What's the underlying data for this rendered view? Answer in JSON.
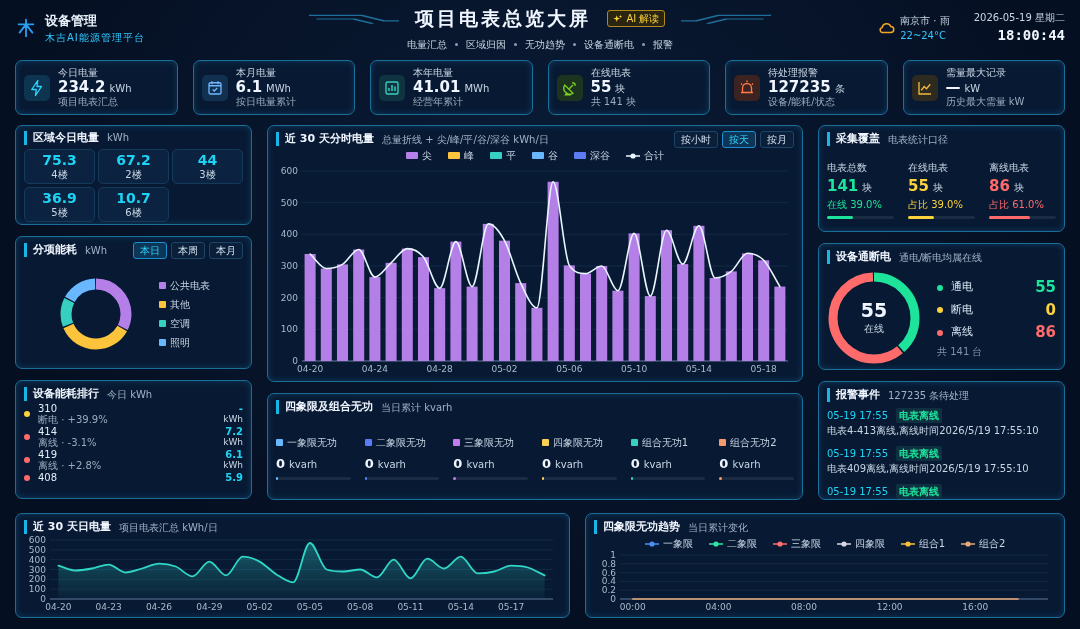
{
  "header": {
    "title": "设备管理",
    "subtitle": "木吉AI能源管理平台",
    "main_title": "项目电表总览大屏",
    "ai_button": "AI 解读",
    "nav": [
      "电量汇总",
      "区域归因",
      "无功趋势",
      "设备通断电",
      "报警"
    ],
    "weather": {
      "city": "南京市 · 雨",
      "temp": "22~24°C"
    },
    "date": "2026-05-19 星期二",
    "time": "18:00:44"
  },
  "kpis": [
    {
      "kind": "bolt",
      "label": "今日电量",
      "value": "234.2",
      "unit": "kWh",
      "note": "项目电表汇总"
    },
    {
      "kind": "calendar",
      "label": "本月电量",
      "value": "6.1",
      "unit": "MWh",
      "note": "按日电量累计"
    },
    {
      "kind": "bars",
      "label": "本年电量",
      "value": "41.01",
      "unit": "MWh",
      "note": "经营年累计"
    },
    {
      "kind": "dish",
      "label": "在线电表",
      "value": "55",
      "unit": "块",
      "note": "共 141 块"
    },
    {
      "kind": "alarm",
      "label": "待处理报警",
      "value": "127235",
      "unit": "条",
      "note": "设备/能耗/状态"
    },
    {
      "kind": "trend",
      "label": "需量最大记录",
      "value": "—",
      "unit": "kW",
      "note": "历史最大需量 kW"
    }
  ],
  "region": {
    "title": "区域今日电量",
    "subtitle": "kWh",
    "cells": [
      {
        "value": "75.3",
        "label": "4楼"
      },
      {
        "value": "67.2",
        "label": "2楼"
      },
      {
        "value": "44",
        "label": "3楼"
      },
      {
        "value": "36.9",
        "label": "5楼"
      },
      {
        "value": "10.7",
        "label": "6楼"
      }
    ]
  },
  "breakdown": {
    "title": "分项能耗",
    "subtitle": "kWh",
    "tabs": [
      {
        "label": "本日",
        "selected": true
      },
      {
        "label": "本周",
        "selected": false
      },
      {
        "label": "本月",
        "selected": false
      }
    ],
    "legend": [
      {
        "label": "公共电表",
        "color": "#b57fe8"
      },
      {
        "label": "其他",
        "color": "#fbc43c"
      },
      {
        "label": "空调",
        "color": "#36cfc0"
      },
      {
        "label": "照明",
        "color": "#69b8ff"
      }
    ]
  },
  "ranking": {
    "title": "设备能耗排行",
    "subtitle": "今日 kWh",
    "items": [
      {
        "name": "310",
        "status": "断电 · +39.9%",
        "value": "-",
        "unit": "kWh",
        "color": "#fbd13c"
      },
      {
        "name": "414",
        "status": "离线 · -3.1%",
        "value": "7.2",
        "unit": "kWh",
        "color": "#ff6b6b"
      },
      {
        "name": "419",
        "status": "离线 · +2.8%",
        "value": "6.1",
        "unit": "kWh",
        "color": "#ff6b6b"
      },
      {
        "name": "408",
        "value": "5.9",
        "color": "#ff6b6b"
      }
    ]
  },
  "daily": {
    "title": "近 30 天分时电量",
    "subtitle": "总量折线 + 尖/峰/平/谷/深谷 kWh/日",
    "tabs": [
      {
        "label": "按小时",
        "selected": false
      },
      {
        "label": "按天",
        "selected": true
      },
      {
        "label": "按月",
        "selected": false
      }
    ],
    "chart_data": {
      "type": "bar",
      "grid": true,
      "categories": [
        "04-20",
        null,
        null,
        null,
        "04-24",
        null,
        null,
        null,
        "04-28",
        null,
        null,
        null,
        "05-02",
        null,
        null,
        null,
        "05-06",
        null,
        null,
        null,
        "05-10",
        null,
        null,
        null,
        "05-14",
        null,
        null,
        null,
        "05-18",
        null
      ],
      "ylim": [
        0,
        600
      ],
      "yticks": [
        0,
        100,
        200,
        300,
        400,
        500,
        600
      ],
      "series": [
        {
          "name": "尖",
          "color": "#b57fe8",
          "values": [
            338,
            292,
            305,
            352,
            265,
            310,
            355,
            328,
            230,
            377,
            235,
            433,
            380,
            246,
            168,
            566,
            302,
            276,
            300,
            222,
            403,
            205,
            413,
            306,
            427,
            262,
            283,
            340,
            318,
            235
          ]
        },
        {
          "name": "峰",
          "color": "#fbc43c",
          "values": [
            0,
            0,
            0,
            0,
            0,
            0,
            0,
            0,
            0,
            0,
            0,
            0,
            0,
            0,
            0,
            0,
            0,
            0,
            0,
            0,
            0,
            0,
            0,
            0,
            0,
            0,
            0,
            0,
            0,
            0
          ]
        },
        {
          "name": "平",
          "color": "#36cfc0",
          "values": [
            0,
            0,
            0,
            0,
            0,
            0,
            0,
            0,
            0,
            0,
            0,
            0,
            0,
            0,
            0,
            0,
            0,
            0,
            0,
            0,
            0,
            0,
            0,
            0,
            0,
            0,
            0,
            0,
            0,
            0
          ]
        },
        {
          "name": "谷",
          "color": "#69b8ff",
          "values": [
            0,
            0,
            0,
            0,
            0,
            0,
            0,
            0,
            0,
            0,
            0,
            0,
            0,
            0,
            0,
            0,
            0,
            0,
            0,
            0,
            0,
            0,
            0,
            0,
            0,
            0,
            0,
            0,
            0,
            0
          ]
        },
        {
          "name": "深谷",
          "color": "#5b7cf5",
          "values": [
            0,
            0,
            0,
            0,
            0,
            0,
            0,
            0,
            0,
            0,
            0,
            0,
            0,
            0,
            0,
            0,
            0,
            0,
            0,
            0,
            0,
            0,
            0,
            0,
            0,
            0,
            0,
            0,
            0,
            0
          ]
        },
        {
          "name": "合计",
          "type": "line",
          "color": "#e8f4ff",
          "values": [
            338,
            292,
            305,
            352,
            265,
            310,
            355,
            328,
            230,
            377,
            235,
            433,
            380,
            246,
            168,
            566,
            302,
            276,
            300,
            222,
            403,
            205,
            413,
            306,
            427,
            262,
            283,
            340,
            318,
            235
          ]
        }
      ]
    }
  },
  "reactive": {
    "title": "四象限及组合无功",
    "subtitle": "当日累计 kvarh",
    "items": [
      {
        "label": "一象限无功",
        "value": "0",
        "unit": "kvarh",
        "color": "#69b8ff",
        "level": 0.03
      },
      {
        "label": "二象限无功",
        "value": "0",
        "unit": "kvarh",
        "color": "#5b7cf5",
        "level": 0.03
      },
      {
        "label": "三象限无功",
        "value": "0",
        "unit": "kvarh",
        "color": "#c27cf0",
        "level": 0.03
      },
      {
        "label": "四象限无功",
        "value": "0",
        "unit": "kvarh",
        "color": "#f9d050",
        "level": 0.03
      },
      {
        "label": "组合无功1",
        "value": "0",
        "unit": "kvarh",
        "color": "#36cfc0",
        "level": 0.03
      },
      {
        "label": "组合无功2",
        "value": "0",
        "unit": "kvarh",
        "color": "#f59a6a",
        "level": 0.03
      }
    ]
  },
  "coverage": {
    "title": "采集覆盖",
    "subtitle": "电表统计口径",
    "items": [
      {
        "label": "电表总数",
        "value": "141",
        "unit": "块",
        "note": "在线 39.0%",
        "color": "#1ee39a",
        "level": 0.39
      },
      {
        "label": "在线电表",
        "value": "55",
        "unit": "块",
        "note": "占比 39.0%",
        "color": "#fbd13c",
        "level": 0.39
      },
      {
        "label": "离线电表",
        "value": "86",
        "unit": "块",
        "note": "占比 61.0%",
        "color": "#ff6b6b",
        "level": 0.61
      }
    ]
  },
  "power": {
    "title": "设备通断电",
    "subtitle": "通电/断电均属在线",
    "center_value": "55",
    "center_label": "在线",
    "items": [
      {
        "label": "通电",
        "value": "55",
        "color": "#1ee39a"
      },
      {
        "label": "断电",
        "value": "0",
        "color": "#fbd13c"
      },
      {
        "label": "离线",
        "value": "86",
        "color": "#ff6b6b"
      }
    ],
    "total": "共 141 台"
  },
  "alerts": {
    "title": "报警事件",
    "subtitle": "127235 条待处理",
    "items": [
      {
        "time": "05-19 17:55",
        "tag": "电表离线",
        "text": "电表4-413离线,离线时间2026/5/19 17:55:10"
      },
      {
        "time": "05-19 17:55",
        "tag": "电表离线",
        "text": "电表409离线,离线时间2026/5/19 17:55:10"
      },
      {
        "time": "05-19 17:55",
        "tag": "电表离线"
      }
    ]
  },
  "trend30": {
    "title": "近 30 天日电量",
    "subtitle": "项目电表汇总 kWh/日",
    "chart_data": {
      "type": "area",
      "grid": true,
      "categories": [
        "04-20",
        null,
        null,
        "04-23",
        null,
        null,
        "04-26",
        null,
        null,
        "04-29",
        null,
        null,
        "05-02",
        null,
        null,
        "05-05",
        null,
        null,
        "05-08",
        null,
        null,
        "05-11",
        null,
        null,
        "05-14",
        null,
        null,
        "05-17",
        null,
        null
      ],
      "ylim": [
        0,
        600
      ],
      "yticks": [
        0,
        100,
        200,
        300,
        400,
        500,
        600
      ],
      "series": [
        {
          "color": "#2fd6c6",
          "values": [
            340,
            290,
            310,
            350,
            270,
            310,
            360,
            330,
            230,
            380,
            240,
            430,
            380,
            250,
            170,
            570,
            300,
            280,
            300,
            220,
            400,
            210,
            410,
            310,
            430,
            260,
            280,
            340,
            320,
            240
          ]
        }
      ]
    }
  },
  "quadrant": {
    "title": "四象限无功趋势",
    "subtitle": "当日累计变化",
    "chart_data": {
      "type": "line",
      "grid": true,
      "x": [
        0,
        18
      ],
      "xlim": [
        -0.6,
        19.4
      ],
      "ylim": [
        0,
        1
      ],
      "yticks": [
        0,
        {
          "value": 0.2,
          "label": "0.2"
        },
        {
          "value": 0.4,
          "label": "0.4"
        },
        {
          "value": 0.6,
          "label": "0.6"
        },
        {
          "value": 0.8,
          "label": "0.8"
        },
        1
      ],
      "xticks": [
        {
          "value": 0,
          "label": "00:00"
        },
        {
          "value": 4,
          "label": "04:00"
        },
        {
          "value": 8,
          "label": "08:00"
        },
        {
          "value": 12,
          "label": "12:00"
        },
        {
          "value": 16,
          "label": "16:00"
        }
      ],
      "series": [
        {
          "name": "一象限",
          "color": "#4d8ff5",
          "values": [
            null,
            null
          ]
        },
        {
          "name": "二象限",
          "color": "#2ee6a6",
          "values": [
            null,
            null
          ]
        },
        {
          "name": "三象限",
          "color": "#ff7070",
          "values": [
            null,
            null
          ]
        },
        {
          "name": "四象限",
          "color": "#d8d8e8",
          "values": [
            null,
            null
          ]
        },
        {
          "name": "组合1",
          "color": "#f9c13a",
          "values": [
            null,
            null
          ]
        },
        {
          "name": "组合2",
          "color": "#e8a878",
          "values": [
            0,
            0
          ]
        }
      ]
    }
  }
}
